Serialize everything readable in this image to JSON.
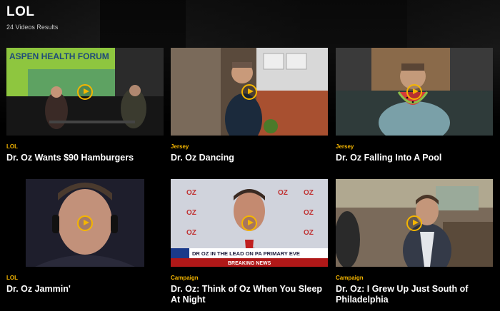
{
  "page": {
    "title": "LOL",
    "results": "24 Videos Results"
  },
  "videos": [
    {
      "category": "LOL",
      "title": "Dr. Oz Wants $90 Hamburgers",
      "thumb_text": "ASPEN HEALTH FORUM"
    },
    {
      "category": "Jersey",
      "title": "Dr. Oz Dancing"
    },
    {
      "category": "Jersey",
      "title": "Dr. Oz Falling Into A Pool"
    },
    {
      "category": "LOL",
      "title": "Dr. Oz Jammin'"
    },
    {
      "category": "Campaign",
      "title": "Dr. Oz: Think of Oz When You Sleep At Night",
      "thumb_text": "DR OZ IN THE LEAD ON PA PRIMARY EVE",
      "thumb_badge": "BREAKING NEWS"
    },
    {
      "category": "Campaign",
      "title": "Dr. Oz: I Grew Up Just South of Philadelphia"
    }
  ],
  "colors": {
    "accent": "#f5b600",
    "background": "#000000"
  },
  "icons": {
    "play": "play-circle-icon"
  }
}
